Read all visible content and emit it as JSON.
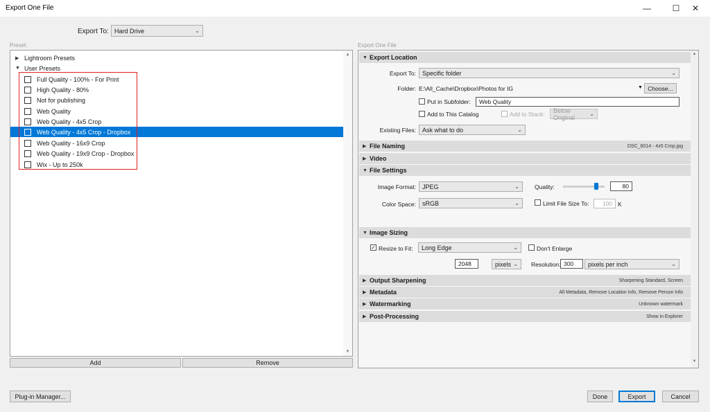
{
  "window": {
    "title": "Export One File",
    "minimize": "—",
    "maximize": "☐",
    "close": "✕"
  },
  "export_to": {
    "label": "Export To:",
    "value": "Hard Drive"
  },
  "presets": {
    "label": "Preset:",
    "groups": [
      {
        "name": "Lightroom Presets",
        "expanded": false
      },
      {
        "name": "User Presets",
        "expanded": true
      }
    ],
    "items": [
      "Full Quality - 100% - For Print",
      "High Quality - 80%",
      "Not for publishing",
      "Web Quality",
      "Web Quality - 4x5 Crop",
      "Web Quality - 4x5 Crop - Dropbox",
      "Web Quality - 16x9 Crop",
      "Web Quality - 19x9 Crop - Dropbox",
      "Wix - Up to 250k"
    ],
    "selected_index": 5,
    "add_label": "Add",
    "remove_label": "Remove"
  },
  "right": {
    "label": "Export One File",
    "export_location": {
      "title": "Export Location",
      "export_to_label": "Export To:",
      "export_to_value": "Specific folder",
      "folder_label": "Folder:",
      "folder_path": "E:\\All_Cache\\Dropbox\\Photos for IG",
      "choose_label": "Choose...",
      "put_in_subfolder_label": "Put in Subfolder:",
      "subfolder_value": "Web Quality",
      "add_to_catalog_label": "Add to This Catalog",
      "add_to_stack_label": "Add to Stack:",
      "stack_value": "Below Original",
      "existing_files_label": "Existing Files:",
      "existing_files_value": "Ask what to do"
    },
    "file_naming": {
      "title": "File Naming",
      "summary": "DSC_6014 - 4x5 Crop.jpg"
    },
    "video": {
      "title": "Video"
    },
    "file_settings": {
      "title": "File Settings",
      "image_format_label": "Image Format:",
      "image_format_value": "JPEG",
      "quality_label": "Quality:",
      "quality_value": "80",
      "quality_fraction": 0.8,
      "color_space_label": "Color Space:",
      "color_space_value": "sRGB",
      "limit_label": "Limit File Size To:",
      "limit_value": "100",
      "limit_unit": "K"
    },
    "image_sizing": {
      "title": "Image Sizing",
      "resize_label": "Resize to Fit:",
      "resize_value": "Long Edge",
      "dont_enlarge_label": "Don't Enlarge",
      "size_value": "2048",
      "size_unit": "pixels",
      "resolution_label": "Resolution:",
      "resolution_value": "300",
      "resolution_unit": "pixels per inch"
    },
    "output_sharpening": {
      "title": "Output Sharpening",
      "summary": "Sharpening Standard, Screen"
    },
    "metadata": {
      "title": "Metadata",
      "summary": "All Metadata, Remove Location Info, Remove Person Info"
    },
    "watermarking": {
      "title": "Watermarking",
      "summary": "Unknown watermark"
    },
    "post_processing": {
      "title": "Post-Processing",
      "summary": "Show in Explorer"
    }
  },
  "footer": {
    "plugin_manager": "Plug-in Manager...",
    "done": "Done",
    "export": "Export",
    "cancel": "Cancel"
  }
}
